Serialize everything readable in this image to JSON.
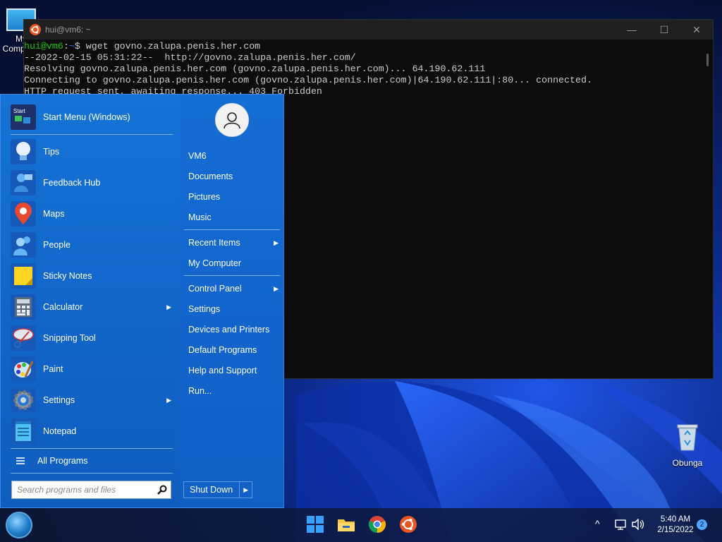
{
  "desktop": {
    "icons": [
      {
        "label": "My Computer"
      },
      {
        "label": "Obunga"
      }
    ]
  },
  "terminal": {
    "title": "hui@vm6: ~",
    "controls": {
      "minimize": "—",
      "maximize": "☐",
      "close": "✕"
    },
    "prompt_user": "hui@vm6",
    "prompt_sep": ":",
    "prompt_path": "~",
    "prompt_end": "$ ",
    "command": "wget govno.zalupa.penis.her.com",
    "output": [
      "--2022-02-15 05:31:22--  http://govno.zalupa.penis.her.com/",
      "Resolving govno.zalupa.penis.her.com (govno.zalupa.penis.her.com)... 64.190.62.111",
      "Connecting to govno.zalupa.penis.her.com (govno.zalupa.penis.her.com)|64.190.62.111|:80... connected.",
      "HTTP request sent, awaiting response... 403 Forbidden"
    ]
  },
  "start_menu": {
    "pinned": {
      "label": "Start Menu (Windows)",
      "icon": "start-menu-icon"
    },
    "programs": [
      {
        "label": "Tips",
        "icon": "lightbulb-icon",
        "has_submenu": false
      },
      {
        "label": "Feedback Hub",
        "icon": "feedback-icon",
        "has_submenu": false
      },
      {
        "label": "Maps",
        "icon": "map-pin-icon",
        "has_submenu": false
      },
      {
        "label": "People",
        "icon": "people-icon",
        "has_submenu": false
      },
      {
        "label": "Sticky Notes",
        "icon": "sticky-note-icon",
        "has_submenu": false
      },
      {
        "label": "Calculator",
        "icon": "calculator-icon",
        "has_submenu": true
      },
      {
        "label": "Snipping Tool",
        "icon": "scissors-icon",
        "has_submenu": false
      },
      {
        "label": "Paint",
        "icon": "palette-icon",
        "has_submenu": false
      },
      {
        "label": "Settings",
        "icon": "gear-icon",
        "has_submenu": true
      },
      {
        "label": "Notepad",
        "icon": "notepad-icon",
        "has_submenu": false
      }
    ],
    "all_programs": "All Programs",
    "search_placeholder": "Search programs and files",
    "places": [
      {
        "label": "VM6",
        "has_submenu": false
      },
      {
        "label": "Documents",
        "has_submenu": false
      },
      {
        "label": "Pictures",
        "has_submenu": false
      },
      {
        "label": "Music",
        "has_submenu": false
      },
      {
        "label": "Recent Items",
        "has_submenu": true
      },
      {
        "label": "My Computer",
        "has_submenu": false
      },
      {
        "label": "Control Panel",
        "has_submenu": true
      },
      {
        "label": "Settings",
        "has_submenu": false
      },
      {
        "label": "Devices and Printers",
        "has_submenu": false
      },
      {
        "label": "Default Programs",
        "has_submenu": false
      },
      {
        "label": "Help and Support",
        "has_submenu": false
      },
      {
        "label": "Run...",
        "has_submenu": false
      }
    ],
    "shutdown": "Shut Down",
    "submenu_arrow": "▶"
  },
  "taskbar": {
    "apps": [
      {
        "icon": "windows-logo-icon"
      },
      {
        "icon": "file-explorer-icon"
      },
      {
        "icon": "chrome-icon"
      },
      {
        "icon": "ubuntu-icon"
      }
    ],
    "tray": {
      "chevron": "^",
      "network_icon": "network-icon",
      "volume_icon": "volume-icon"
    },
    "clock": {
      "time": "5:40 AM",
      "date": "2/15/2022"
    },
    "notifications": "2"
  },
  "colors": {
    "start_menu_bg": "#1573d6",
    "terminal_bg": "#0c0c0c",
    "prompt_green": "#16c60c",
    "prompt_blue": "#3b78ff"
  }
}
